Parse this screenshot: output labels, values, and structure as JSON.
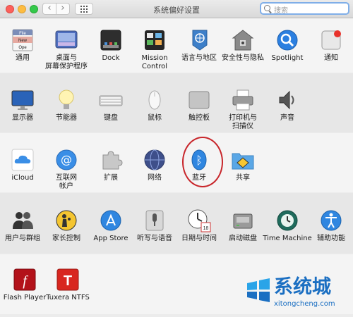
{
  "window": {
    "title": "系统偏好设置",
    "search_placeholder": "搜索"
  },
  "toolbar": {
    "back": "‹",
    "forward": "›"
  },
  "rows": [
    [
      {
        "id": "general",
        "label": "通用",
        "icon": "general-icon",
        "icon_text": [
          "File",
          "New",
          "Ope"
        ]
      },
      {
        "id": "desktop",
        "label": "桌面与\n屏幕保护程序",
        "icon": "desktop-screensaver-icon"
      },
      {
        "id": "dock",
        "label": "Dock",
        "icon": "dock-icon"
      },
      {
        "id": "mission",
        "label": "Mission\nControl",
        "icon": "mission-control-icon"
      },
      {
        "id": "language",
        "label": "语言与地区",
        "icon": "language-region-icon"
      },
      {
        "id": "security",
        "label": "安全性与隐私",
        "icon": "security-privacy-icon"
      },
      {
        "id": "spotlight",
        "label": "Spotlight",
        "icon": "spotlight-icon"
      },
      {
        "id": "notifications",
        "label": "通知",
        "icon": "notifications-icon"
      }
    ],
    [
      {
        "id": "displays",
        "label": "显示器",
        "icon": "displays-icon"
      },
      {
        "id": "energy",
        "label": "节能器",
        "icon": "energy-saver-icon"
      },
      {
        "id": "keyboard",
        "label": "键盘",
        "icon": "keyboard-icon"
      },
      {
        "id": "mouse",
        "label": "鼠标",
        "icon": "mouse-icon"
      },
      {
        "id": "trackpad",
        "label": "触控板",
        "icon": "trackpad-icon"
      },
      {
        "id": "printers",
        "label": "打印机与\n扫描仪",
        "icon": "printers-scanners-icon"
      },
      {
        "id": "sound",
        "label": "声音",
        "icon": "sound-icon"
      }
    ],
    [
      {
        "id": "icloud",
        "label": "iCloud",
        "icon": "icloud-icon"
      },
      {
        "id": "internet",
        "label": "互联网\n帐户",
        "icon": "internet-accounts-icon",
        "icon_text": [
          "@"
        ]
      },
      {
        "id": "extensions",
        "label": "扩展",
        "icon": "extensions-icon"
      },
      {
        "id": "network",
        "label": "网络",
        "icon": "network-icon"
      },
      {
        "id": "bluetooth",
        "label": "蓝牙",
        "icon": "bluetooth-icon",
        "icon_text": [
          "ᛒ"
        ]
      },
      {
        "id": "sharing",
        "label": "共享",
        "icon": "sharing-icon"
      }
    ],
    [
      {
        "id": "users",
        "label": "用户与群组",
        "icon": "users-groups-icon"
      },
      {
        "id": "parental",
        "label": "家长控制",
        "icon": "parental-controls-icon"
      },
      {
        "id": "appstore",
        "label": "App Store",
        "icon": "app-store-icon"
      },
      {
        "id": "dictation",
        "label": "听写与语音",
        "icon": "dictation-speech-icon"
      },
      {
        "id": "datetime",
        "label": "日期与时间",
        "icon": "date-time-icon",
        "icon_text": [
          "18"
        ]
      },
      {
        "id": "startup",
        "label": "启动磁盘",
        "icon": "startup-disk-icon"
      },
      {
        "id": "timemachine",
        "label": "Time Machine",
        "icon": "time-machine-icon"
      },
      {
        "id": "accessibility",
        "label": "辅助功能",
        "icon": "accessibility-icon"
      }
    ],
    [
      {
        "id": "flash",
        "label": "Flash Player",
        "icon": "flash-player-icon",
        "icon_text": [
          "f"
        ]
      },
      {
        "id": "tuxera",
        "label": "Tuxera NTFS",
        "icon": "tuxera-ntfs-icon",
        "icon_text": [
          "T"
        ]
      }
    ]
  ],
  "watermark": {
    "text": "系统城",
    "url": "xitongcheng.com"
  },
  "colors": {
    "highlight_ring": "#c8262b",
    "search_focus": "#7faee8",
    "watermark": "#1b6fc2"
  }
}
